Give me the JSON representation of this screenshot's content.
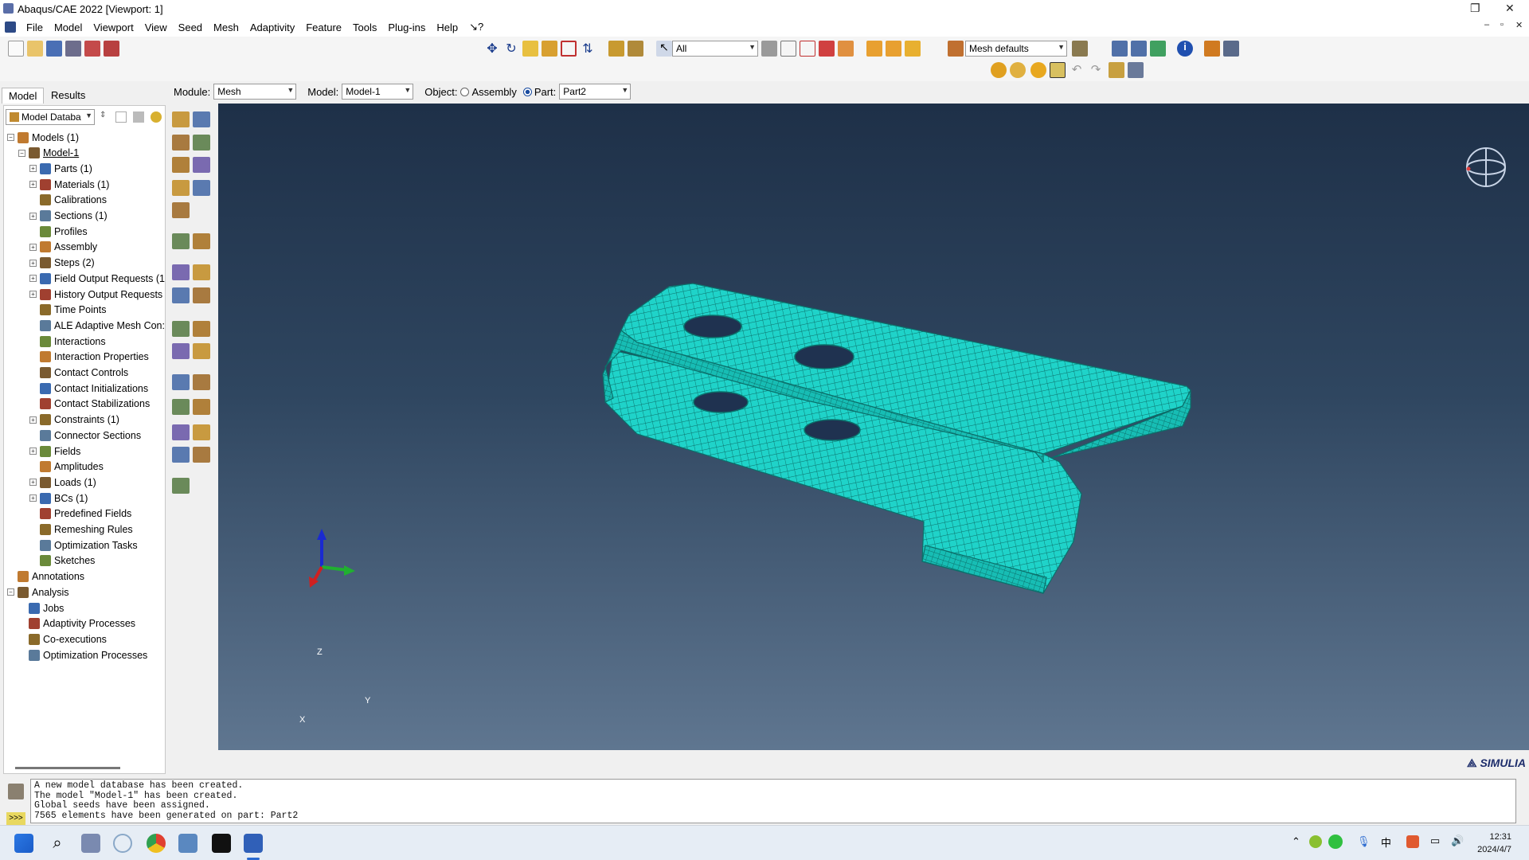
{
  "window": {
    "title": "Abaqus/CAE 2022 [Viewport: 1]"
  },
  "menu": [
    "File",
    "Model",
    "Viewport",
    "View",
    "Seed",
    "Mesh",
    "Adaptivity",
    "Feature",
    "Tools",
    "Plug-ins",
    "Help",
    "↘?"
  ],
  "toolbar": {
    "selection_filter": "All",
    "mesh_defaults": "Mesh defaults"
  },
  "context": {
    "module_label": "Module:",
    "module_value": "Mesh",
    "model_label": "Model:",
    "model_value": "Model-1",
    "object_label": "Object:",
    "assembly_label": "Assembly",
    "part_label": "Part:",
    "part_value": "Part2"
  },
  "tabs": {
    "model": "Model",
    "results": "Results"
  },
  "tree_header": {
    "selector": "Model Databa"
  },
  "tree": [
    {
      "label": "Models (1)",
      "level": 0,
      "exp": "-"
    },
    {
      "label": "Model-1",
      "level": 1,
      "exp": "-",
      "underline": true
    },
    {
      "label": "Parts (1)",
      "level": 2,
      "exp": "+"
    },
    {
      "label": "Materials (1)",
      "level": 2,
      "exp": "+"
    },
    {
      "label": "Calibrations",
      "level": 2,
      "exp": ""
    },
    {
      "label": "Sections (1)",
      "level": 2,
      "exp": "+"
    },
    {
      "label": "Profiles",
      "level": 2,
      "exp": ""
    },
    {
      "label": "Assembly",
      "level": 2,
      "exp": "+"
    },
    {
      "label": "Steps (2)",
      "level": 2,
      "exp": "+"
    },
    {
      "label": "Field Output Requests (1",
      "level": 2,
      "exp": "+"
    },
    {
      "label": "History Output Requests",
      "level": 2,
      "exp": "+"
    },
    {
      "label": "Time Points",
      "level": 2,
      "exp": ""
    },
    {
      "label": "ALE Adaptive Mesh Con:",
      "level": 2,
      "exp": ""
    },
    {
      "label": "Interactions",
      "level": 2,
      "exp": ""
    },
    {
      "label": "Interaction Properties",
      "level": 2,
      "exp": ""
    },
    {
      "label": "Contact Controls",
      "level": 2,
      "exp": ""
    },
    {
      "label": "Contact Initializations",
      "level": 2,
      "exp": ""
    },
    {
      "label": "Contact Stabilizations",
      "level": 2,
      "exp": ""
    },
    {
      "label": "Constraints (1)",
      "level": 2,
      "exp": "+"
    },
    {
      "label": "Connector Sections",
      "level": 2,
      "exp": ""
    },
    {
      "label": "Fields",
      "level": 2,
      "exp": "+"
    },
    {
      "label": "Amplitudes",
      "level": 2,
      "exp": ""
    },
    {
      "label": "Loads (1)",
      "level": 2,
      "exp": "+"
    },
    {
      "label": "BCs (1)",
      "level": 2,
      "exp": "+"
    },
    {
      "label": "Predefined Fields",
      "level": 2,
      "exp": ""
    },
    {
      "label": "Remeshing Rules",
      "level": 2,
      "exp": ""
    },
    {
      "label": "Optimization Tasks",
      "level": 2,
      "exp": ""
    },
    {
      "label": "Sketches",
      "level": 2,
      "exp": ""
    },
    {
      "label": "Annotations",
      "level": 0,
      "exp": ""
    },
    {
      "label": "Analysis",
      "level": 0,
      "exp": "-"
    },
    {
      "label": "Jobs",
      "level": 1,
      "exp": ""
    },
    {
      "label": "Adaptivity Processes",
      "level": 1,
      "exp": ""
    },
    {
      "label": "Co-executions",
      "level": 1,
      "exp": ""
    },
    {
      "label": "Optimization Processes",
      "level": 1,
      "exp": ""
    }
  ],
  "triad": {
    "z": "Z",
    "y": "Y",
    "x": "X"
  },
  "brand": "SIMULIA",
  "messages": [
    "A new model database has been created.",
    "The model \"Model-1\" has been created.",
    "Global seeds have been assigned.",
    "7565 elements have been generated on part: Part2"
  ],
  "clock": {
    "time": "12:31",
    "date": "2024/4/7"
  },
  "colors": {
    "mesh": "#1fd3c9",
    "mesh_lines": "#0b6f6a",
    "viewport_top": "#1e3048",
    "viewport_bottom": "#5f7690"
  }
}
